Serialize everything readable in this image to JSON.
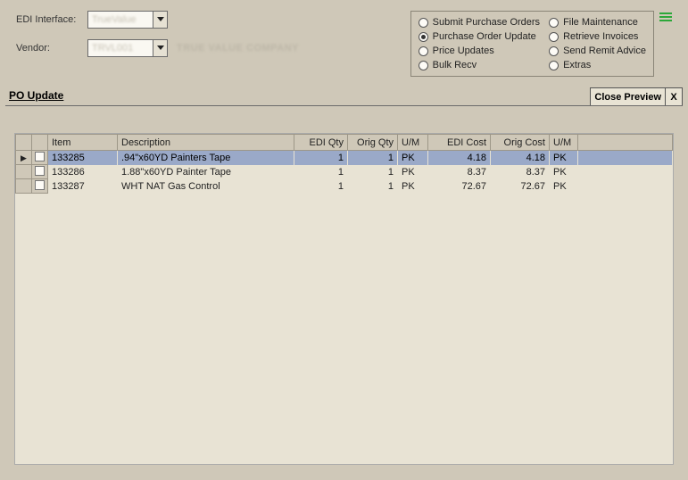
{
  "form": {
    "edi_label": "EDI Interface:",
    "edi_value": "TrueValue",
    "vendor_label": "Vendor:",
    "vendor_value": "TRVL001",
    "vendor_name": "TRUE VALUE COMPANY"
  },
  "radios": {
    "col1": [
      "Submit Purchase Orders",
      "Purchase Order Update",
      "Price Updates",
      "Bulk Recv"
    ],
    "col2": [
      "File Maintenance",
      "Retrieve Invoices",
      "Send Remit Advice",
      "Extras"
    ],
    "selected": "Purchase Order Update"
  },
  "section": {
    "title": "PO Update",
    "close_preview": "Close Preview",
    "x": "X"
  },
  "grid": {
    "headers": {
      "item": "Item",
      "desc": "Description",
      "edi_qty": "EDI Qty",
      "orig_qty": "Orig Qty",
      "um1": "U/M",
      "edi_cost": "EDI Cost",
      "orig_cost": "Orig Cost",
      "um2": "U/M"
    },
    "rows": [
      {
        "item": "133285",
        "desc": ".94\"x60YD Painters Tape",
        "edi_qty": "1",
        "orig_qty": "1",
        "um1": "PK",
        "edi_cost": "4.18",
        "orig_cost": "4.18",
        "um2": "PK",
        "selected": true
      },
      {
        "item": "133286",
        "desc": "1.88\"x60YD Painter Tape",
        "edi_qty": "1",
        "orig_qty": "1",
        "um1": "PK",
        "edi_cost": "8.37",
        "orig_cost": "8.37",
        "um2": "PK",
        "selected": false
      },
      {
        "item": "133287",
        "desc": "WHT NAT Gas Control",
        "edi_qty": "1",
        "orig_qty": "1",
        "um1": "PK",
        "edi_cost": "72.67",
        "orig_cost": "72.67",
        "um2": "PK",
        "selected": false
      }
    ]
  }
}
